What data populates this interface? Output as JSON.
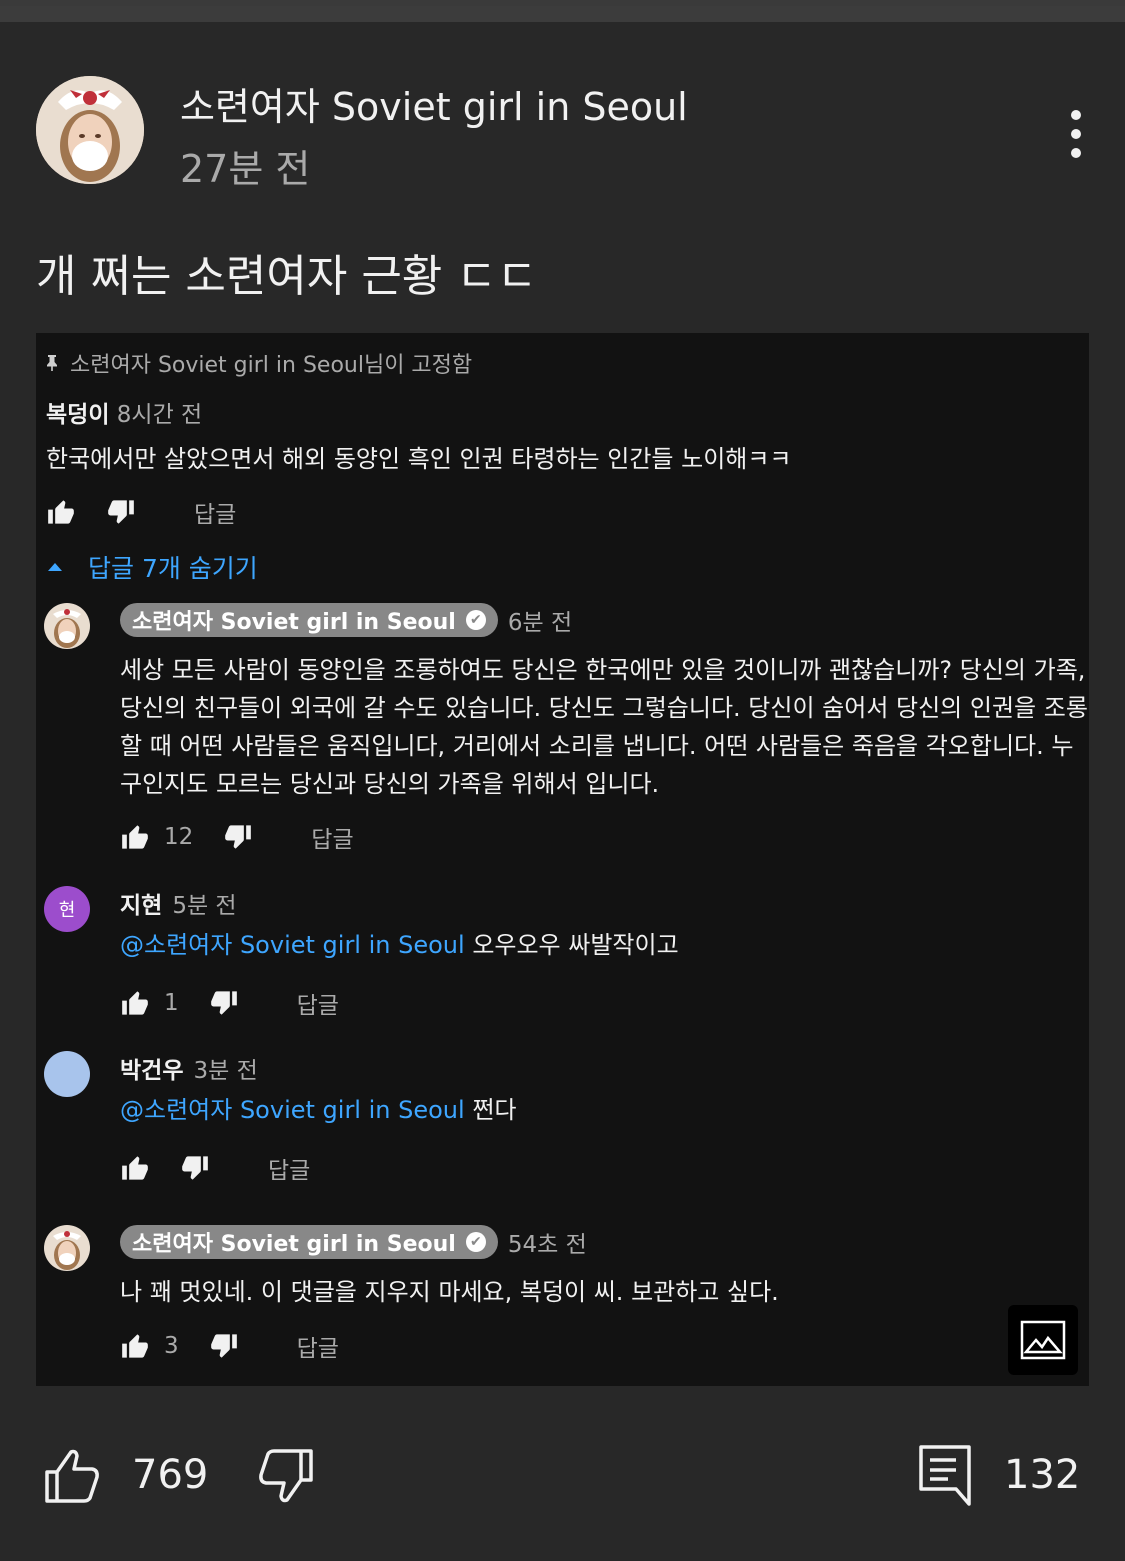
{
  "post": {
    "channel_name": "소련여자 Soviet girl in Seoul",
    "time": "27분 전",
    "text": "개 쩌는 소련여자 근황 ㄷㄷ",
    "more_icon": "more-vert-icon"
  },
  "screenshot": {
    "pinned_label": "소련여자 Soviet girl in Seoul님이 고정함",
    "top_comment": {
      "author": "복덩이",
      "time": "8시간 전",
      "text": "한국에서만 살았으면서 해외 동양인 흑인 인권 타령하는 인간들 노이해ㅋㅋ",
      "reply_label": "답글"
    },
    "hide_replies": "답글 7개 숨기기",
    "replies": [
      {
        "author": "소련여자 Soviet girl in Seoul",
        "verified_mark": "✔",
        "time": "6분 전",
        "text": "세상 모든 사람이 동양인을 조롱하여도 당신은 한국에만 있을 것이니까 괜찮습니까? 당신의 가족, 당신의 친구들이 외국에 갈 수도 있습니다. 당신도 그렇습니다. 당신이 숨어서 당신의 인권을 조롱할 때 어떤 사람들은 움직입니다, 거리에서 소리를 냅니다. 어떤 사람들은 죽음을 각오합니다. 누구인지도 모르는 당신과 당신의 가족을 위해서 입니다.",
        "likes": "12",
        "reply_label": "답글"
      },
      {
        "author": "지현",
        "avatar_letter": "현",
        "time": "5분 전",
        "mention": "@소련여자 Soviet girl in Seoul",
        "text": " 오우오우 싸발작이고",
        "likes": "1",
        "reply_label": "답글"
      },
      {
        "author": "박건우",
        "time": "3분 전",
        "mention": "@소련여자 Soviet girl in Seoul",
        "text": " 쩐다",
        "reply_label": "답글"
      },
      {
        "author": "소련여자 Soviet girl in Seoul",
        "verified_mark": "✔",
        "time": "54초 전",
        "text": "나 꽤 멋있네. 이 댓글을 지우지 마세요, 복덩이 씨. 보관하고 싶다.",
        "likes": "3",
        "reply_label": "답글"
      }
    ]
  },
  "bottom_bar": {
    "likes": "769",
    "comments": "132"
  },
  "colors": {
    "background": "#282828",
    "panel": "#121212",
    "link": "#3ea6ff",
    "text": "#f1f1f1",
    "secondary_text": "#aaaaaa",
    "owner_pill": "#888888"
  }
}
